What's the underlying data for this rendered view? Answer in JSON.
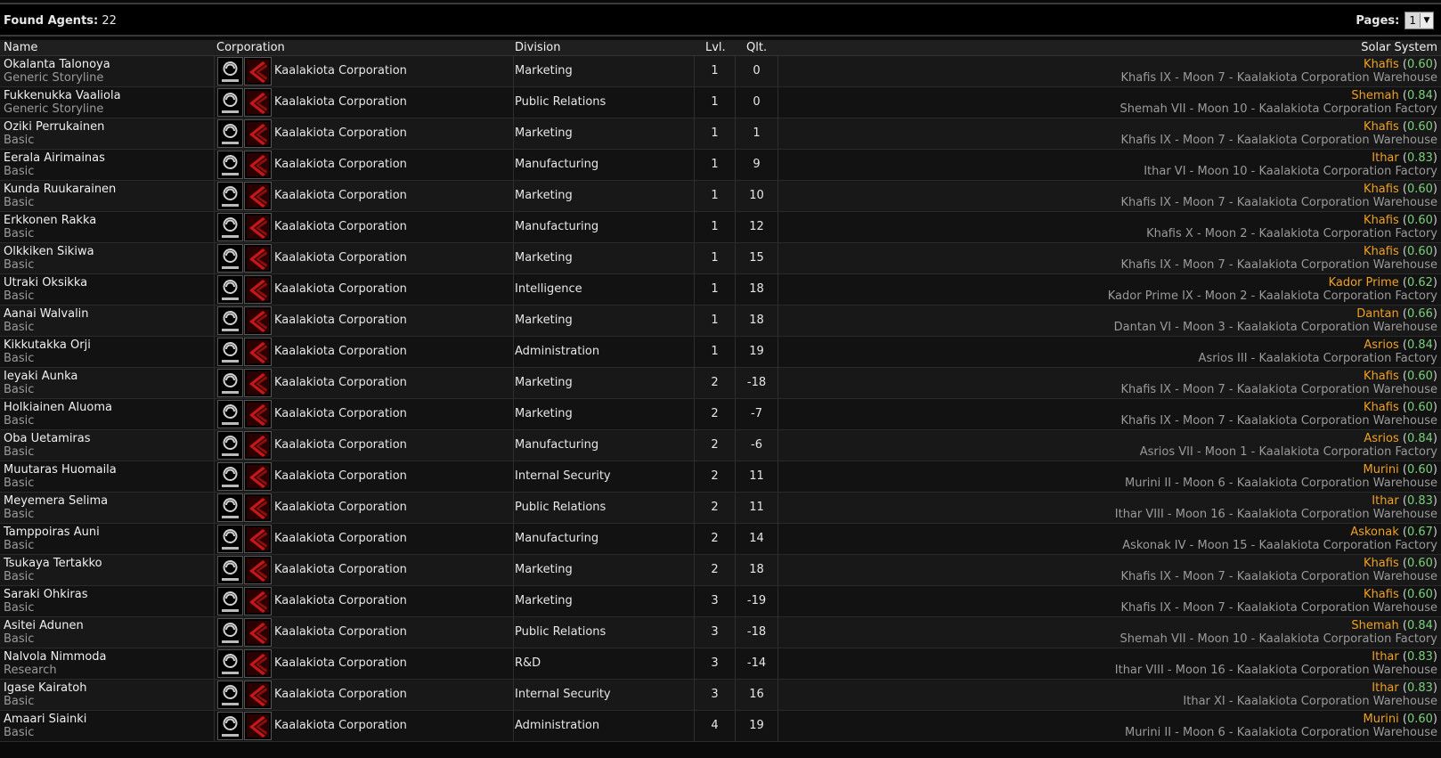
{
  "header": {
    "found_label": "Found Agents:",
    "found_count": "22",
    "pages_label": "Pages:",
    "pages_value": "1"
  },
  "columns": {
    "name": "Name",
    "corporation": "Corporation",
    "division": "Division",
    "level": "Lvl.",
    "quality": "Qlt.",
    "solar_system": "Solar System"
  },
  "colors": {
    "system": "#f0a020",
    "security": "#7ad07a",
    "background": "#0a0a0a"
  },
  "icons": {
    "logo1": "caldari-icon",
    "logo2": "kaalakiota-icon"
  },
  "agents": [
    {
      "name": "Okalanta Talonoya",
      "type": "Generic Storyline",
      "corp": "Kaalakiota Corporation",
      "division": "Marketing",
      "lvl": "1",
      "qlt": "0",
      "system": "Khafis",
      "sec": "0.60",
      "station": "Khafis IX - Moon 7 - Kaalakiota Corporation Warehouse"
    },
    {
      "name": "Fukkenukka Vaaliola",
      "type": "Generic Storyline",
      "corp": "Kaalakiota Corporation",
      "division": "Public Relations",
      "lvl": "1",
      "qlt": "0",
      "system": "Shemah",
      "sec": "0.84",
      "station": "Shemah VII - Moon 10 - Kaalakiota Corporation Factory"
    },
    {
      "name": "Oziki Perrukainen",
      "type": "Basic",
      "corp": "Kaalakiota Corporation",
      "division": "Marketing",
      "lvl": "1",
      "qlt": "1",
      "system": "Khafis",
      "sec": "0.60",
      "station": "Khafis IX - Moon 7 - Kaalakiota Corporation Warehouse"
    },
    {
      "name": "Eerala Airimainas",
      "type": "Basic",
      "corp": "Kaalakiota Corporation",
      "division": "Manufacturing",
      "lvl": "1",
      "qlt": "9",
      "system": "Ithar",
      "sec": "0.83",
      "station": "Ithar VI - Moon 10 - Kaalakiota Corporation Factory"
    },
    {
      "name": "Kunda Ruukarainen",
      "type": "Basic",
      "corp": "Kaalakiota Corporation",
      "division": "Marketing",
      "lvl": "1",
      "qlt": "10",
      "system": "Khafis",
      "sec": "0.60",
      "station": "Khafis IX - Moon 7 - Kaalakiota Corporation Warehouse"
    },
    {
      "name": "Erkkonen Rakka",
      "type": "Basic",
      "corp": "Kaalakiota Corporation",
      "division": "Manufacturing",
      "lvl": "1",
      "qlt": "12",
      "system": "Khafis",
      "sec": "0.60",
      "station": "Khafis X - Moon 2 - Kaalakiota Corporation Factory"
    },
    {
      "name": "Olkkiken Sikiwa",
      "type": "Basic",
      "corp": "Kaalakiota Corporation",
      "division": "Marketing",
      "lvl": "1",
      "qlt": "15",
      "system": "Khafis",
      "sec": "0.60",
      "station": "Khafis IX - Moon 7 - Kaalakiota Corporation Warehouse"
    },
    {
      "name": "Utraki Oksikka",
      "type": "Basic",
      "corp": "Kaalakiota Corporation",
      "division": "Intelligence",
      "lvl": "1",
      "qlt": "18",
      "system": "Kador Prime",
      "sec": "0.62",
      "station": "Kador Prime IX - Moon 2 - Kaalakiota Corporation Factory"
    },
    {
      "name": "Aanai Walvalin",
      "type": "Basic",
      "corp": "Kaalakiota Corporation",
      "division": "Marketing",
      "lvl": "1",
      "qlt": "18",
      "system": "Dantan",
      "sec": "0.66",
      "station": "Dantan VI - Moon 3 - Kaalakiota Corporation Warehouse"
    },
    {
      "name": "Kikkutakka Orji",
      "type": "Basic",
      "corp": "Kaalakiota Corporation",
      "division": "Administration",
      "lvl": "1",
      "qlt": "19",
      "system": "Asrios",
      "sec": "0.84",
      "station": "Asrios III - Kaalakiota Corporation Factory"
    },
    {
      "name": "Ieyaki Aunka",
      "type": "Basic",
      "corp": "Kaalakiota Corporation",
      "division": "Marketing",
      "lvl": "2",
      "qlt": "-18",
      "system": "Khafis",
      "sec": "0.60",
      "station": "Khafis IX - Moon 7 - Kaalakiota Corporation Warehouse"
    },
    {
      "name": "Holkiainen Aluoma",
      "type": "Basic",
      "corp": "Kaalakiota Corporation",
      "division": "Marketing",
      "lvl": "2",
      "qlt": "-7",
      "system": "Khafis",
      "sec": "0.60",
      "station": "Khafis IX - Moon 7 - Kaalakiota Corporation Warehouse"
    },
    {
      "name": "Oba Uetamiras",
      "type": "Basic",
      "corp": "Kaalakiota Corporation",
      "division": "Manufacturing",
      "lvl": "2",
      "qlt": "-6",
      "system": "Asrios",
      "sec": "0.84",
      "station": "Asrios VII - Moon 1 - Kaalakiota Corporation Factory"
    },
    {
      "name": "Muutaras Huomaila",
      "type": "Basic",
      "corp": "Kaalakiota Corporation",
      "division": "Internal Security",
      "lvl": "2",
      "qlt": "11",
      "system": "Murini",
      "sec": "0.60",
      "station": "Murini II - Moon 6 - Kaalakiota Corporation Warehouse"
    },
    {
      "name": "Meyemera Selima",
      "type": "Basic",
      "corp": "Kaalakiota Corporation",
      "division": "Public Relations",
      "lvl": "2",
      "qlt": "11",
      "system": "Ithar",
      "sec": "0.83",
      "station": "Ithar VIII - Moon 16 - Kaalakiota Corporation Warehouse"
    },
    {
      "name": "Tamppoiras Auni",
      "type": "Basic",
      "corp": "Kaalakiota Corporation",
      "division": "Manufacturing",
      "lvl": "2",
      "qlt": "14",
      "system": "Askonak",
      "sec": "0.67",
      "station": "Askonak IV - Moon 15 - Kaalakiota Corporation Factory"
    },
    {
      "name": "Tsukaya Tertakko",
      "type": "Basic",
      "corp": "Kaalakiota Corporation",
      "division": "Marketing",
      "lvl": "2",
      "qlt": "18",
      "system": "Khafis",
      "sec": "0.60",
      "station": "Khafis IX - Moon 7 - Kaalakiota Corporation Warehouse"
    },
    {
      "name": "Saraki Ohkiras",
      "type": "Basic",
      "corp": "Kaalakiota Corporation",
      "division": "Marketing",
      "lvl": "3",
      "qlt": "-19",
      "system": "Khafis",
      "sec": "0.60",
      "station": "Khafis IX - Moon 7 - Kaalakiota Corporation Warehouse"
    },
    {
      "name": "Asitei Adunen",
      "type": "Basic",
      "corp": "Kaalakiota Corporation",
      "division": "Public Relations",
      "lvl": "3",
      "qlt": "-18",
      "system": "Shemah",
      "sec": "0.84",
      "station": "Shemah VII - Moon 10 - Kaalakiota Corporation Factory"
    },
    {
      "name": "Nalvola Nimmoda",
      "type": "Research",
      "corp": "Kaalakiota Corporation",
      "division": "R&D",
      "lvl": "3",
      "qlt": "-14",
      "system": "Ithar",
      "sec": "0.83",
      "station": "Ithar VIII - Moon 16 - Kaalakiota Corporation Warehouse"
    },
    {
      "name": "Igase Kairatoh",
      "type": "Basic",
      "corp": "Kaalakiota Corporation",
      "division": "Internal Security",
      "lvl": "3",
      "qlt": "16",
      "system": "Ithar",
      "sec": "0.83",
      "station": "Ithar XI - Kaalakiota Corporation Warehouse"
    },
    {
      "name": "Amaari Siainki",
      "type": "Basic",
      "corp": "Kaalakiota Corporation",
      "division": "Administration",
      "lvl": "4",
      "qlt": "19",
      "system": "Murini",
      "sec": "0.60",
      "station": "Murini II - Moon 6 - Kaalakiota Corporation Warehouse"
    }
  ]
}
